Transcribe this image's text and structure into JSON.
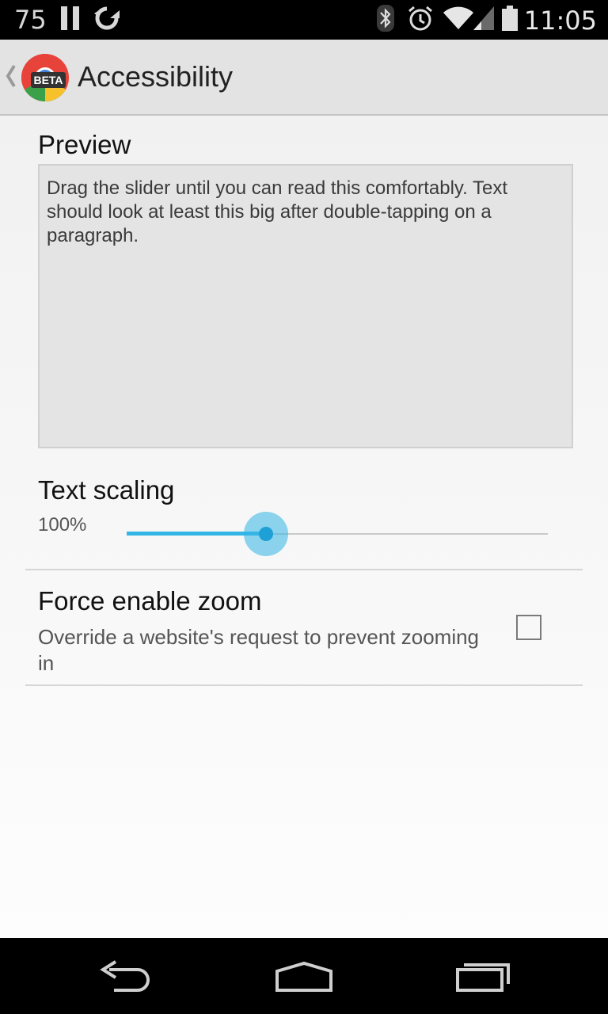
{
  "status_bar": {
    "notification_number": "75",
    "time": "11:05",
    "icons": [
      "pause-icon",
      "sync-icon",
      "bluetooth-icon",
      "alarm-icon",
      "wifi-icon",
      "signal-icon",
      "battery-icon"
    ]
  },
  "action_bar": {
    "title": "Accessibility",
    "logo_badge": "BETA",
    "up_icon": "chevron-left-icon"
  },
  "preview": {
    "title": "Preview",
    "text": "Drag the slider until you can read this comfortably. Text should look at least this big after double-tapping on a paragraph."
  },
  "text_scaling": {
    "title": "Text scaling",
    "value_label": "100%",
    "slider_fraction": 0.33,
    "accent_color": "#33b5e5"
  },
  "force_zoom": {
    "title": "Force enable zoom",
    "summary": "Override a website's request to prevent zooming in",
    "checked": false
  },
  "nav_bar": {
    "icons": [
      "back-icon",
      "home-icon",
      "recents-icon"
    ]
  }
}
